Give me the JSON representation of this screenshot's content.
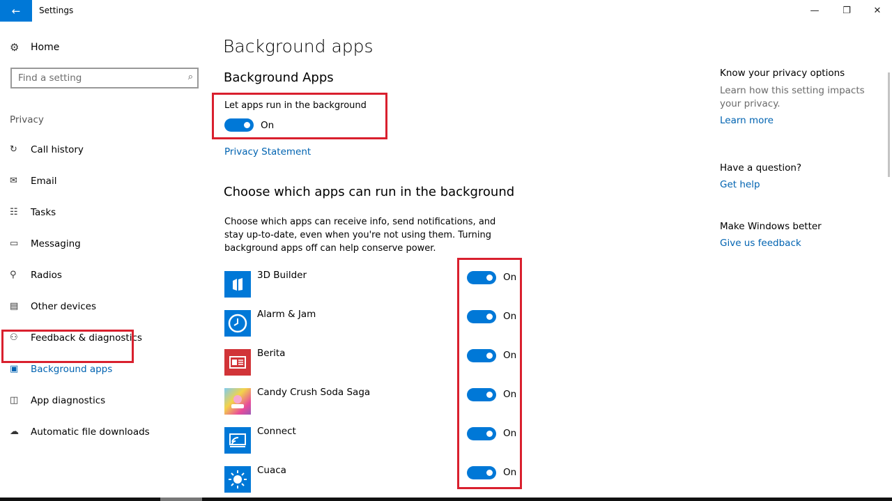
{
  "window": {
    "title": "Settings",
    "back_icon": "←",
    "minimize_icon": "—",
    "maximize_icon": "❐",
    "close_icon": "✕"
  },
  "sidebar": {
    "home_label": "Home",
    "home_icon": "⚙",
    "search_placeholder": "Find a setting",
    "search_icon": "⌕",
    "section_label": "Privacy",
    "items": [
      {
        "label": "Call history",
        "icon": "↻"
      },
      {
        "label": "Email",
        "icon": "✉"
      },
      {
        "label": "Tasks",
        "icon": "☷"
      },
      {
        "label": "Messaging",
        "icon": "▭"
      },
      {
        "label": "Radios",
        "icon": "⚲"
      },
      {
        "label": "Other devices",
        "icon": "▤"
      },
      {
        "label": "Feedback & diagnostics",
        "icon": "⚇"
      },
      {
        "label": "Background apps",
        "icon": "▣"
      },
      {
        "label": "App diagnostics",
        "icon": "◫"
      },
      {
        "label": "Automatic file downloads",
        "icon": "☁"
      }
    ],
    "active_item": "Background apps"
  },
  "main": {
    "page_title": "Background apps",
    "section_title": "Background Apps",
    "toggle_label": "Let apps run in the background",
    "toggle_state": "On",
    "privacy_link": "Privacy Statement",
    "choose_title": "Choose which apps can run in the background",
    "choose_description": "Choose which apps can receive info, send notifications, and stay up-to-date, even when you're not using them. Turning background apps off can help conserve power.",
    "apps": [
      {
        "name": "3D Builder",
        "state": "On",
        "color": "#0078d7"
      },
      {
        "name": "Alarm & Jam",
        "state": "On",
        "color": "#0078d7"
      },
      {
        "name": "Berita",
        "state": "On",
        "color": "#d13438"
      },
      {
        "name": "Candy Crush Soda Saga",
        "state": "On",
        "color": "#c239b3"
      },
      {
        "name": "Connect",
        "state": "On",
        "color": "#0078d7"
      },
      {
        "name": "Cuaca",
        "state": "On",
        "color": "#0078d7"
      }
    ]
  },
  "right_panel": {
    "privacy_head": "Know your privacy options",
    "privacy_text": "Learn how this setting impacts your privacy.",
    "privacy_link": "Learn more",
    "question_head": "Have a question?",
    "question_link": "Get help",
    "better_head": "Make Windows better",
    "better_link": "Give us feedback"
  },
  "colors": {
    "accent": "#0078d7",
    "link": "#0063b1",
    "highlight": "#d9202e"
  }
}
